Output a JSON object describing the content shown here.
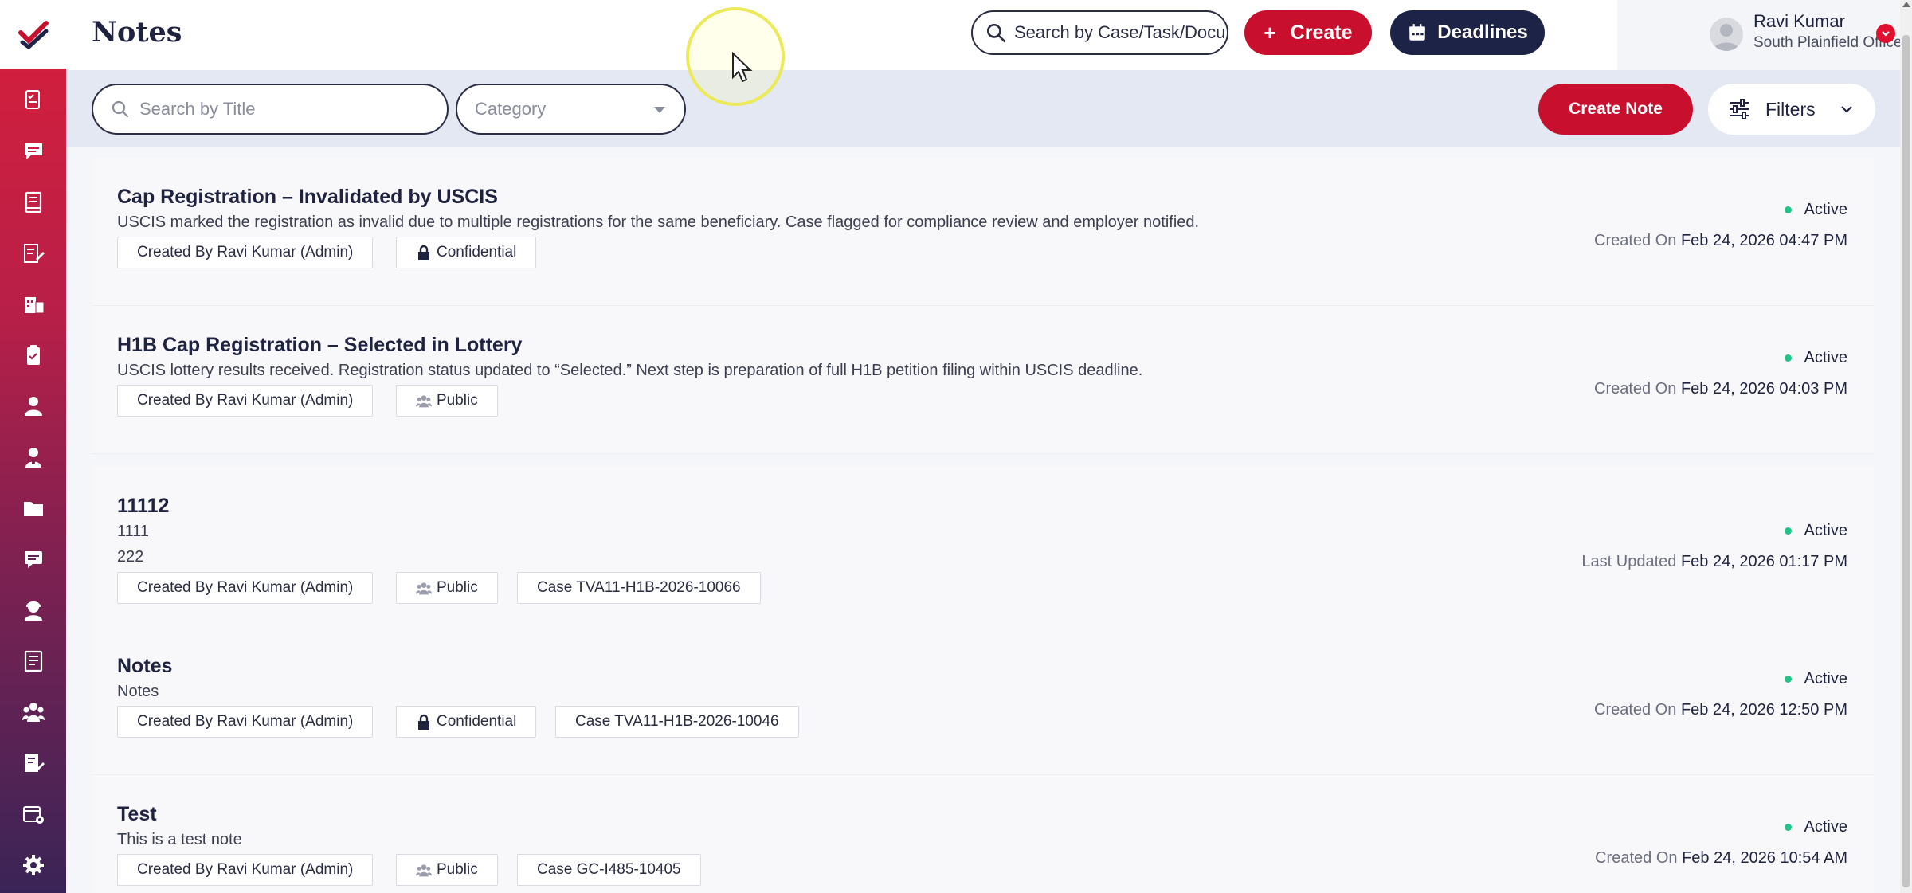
{
  "app": {
    "title": "Notes"
  },
  "header": {
    "global_search_placeholder": "Search by Case/Task/Docu",
    "create_label": "Create",
    "create_icon": "+",
    "deadlines_label": "Deadlines",
    "user": {
      "name": "Ravi Kumar",
      "office": "South Plainfield Office"
    }
  },
  "filters": {
    "title_search_placeholder": "Search by Title",
    "category_placeholder": "Category",
    "create_note_label": "Create Note",
    "filters_label": "Filters"
  },
  "sidebar": {
    "icons": [
      "checklist-doc-icon",
      "chat-icon",
      "book-icon",
      "document-edit-icon",
      "building-doc-icon",
      "clipboard-icon",
      "person-icon",
      "user-icon",
      "folder-icon",
      "message-icon",
      "support-agent-icon",
      "ledger-icon",
      "group-icon",
      "signed-doc-icon",
      "calendar-settings-icon",
      "settings-icon"
    ]
  },
  "notes": [
    {
      "title": "Cap Registration – Invalidated by USCIS",
      "lines": [
        "USCIS marked the registration as invalid due to multiple registrations for the same beneficiary. Case flagged for compliance review and employer notified."
      ],
      "created_by": "Created By Ravi Kumar (Admin)",
      "visibility": "Confidential",
      "visibility_icon": "lock-icon",
      "status": "Active",
      "meta_label": "Created On",
      "meta_value": "Feb 24, 2026 04:47 PM"
    },
    {
      "title": "H1B Cap Registration – Selected in Lottery",
      "lines": [
        "USCIS lottery results received. Registration status updated to “Selected.” Next step is preparation of full H1B petition filing within USCIS deadline."
      ],
      "created_by": "Created By Ravi Kumar (Admin)",
      "visibility": "Public",
      "visibility_icon": "group-icon",
      "status": "Active",
      "meta_label": "Created On",
      "meta_value": "Feb 24, 2026 04:03 PM"
    },
    {
      "title": "11112",
      "lines": [
        "1111",
        "222"
      ],
      "created_by": "Created By Ravi Kumar (Admin)",
      "visibility": "Public",
      "visibility_icon": "group-icon",
      "case": "Case TVA11-H1B-2026-10066",
      "status": "Active",
      "meta_label": "Last Updated",
      "meta_value": "Feb 24, 2026 01:17 PM"
    },
    {
      "title": "Notes",
      "lines": [
        "Notes"
      ],
      "created_by": "Created By Ravi Kumar (Admin)",
      "visibility": "Confidential",
      "visibility_icon": "lock-icon",
      "case": "Case TVA11-H1B-2026-10046",
      "status": "Active",
      "meta_label": "Created On",
      "meta_value": "Feb 24, 2026 12:50 PM"
    },
    {
      "title": "Test",
      "lines": [
        "This is a test note"
      ],
      "created_by": "Created By Ravi Kumar (Admin)",
      "visibility": "Public",
      "visibility_icon": "group-icon",
      "case": "Case GC-I485-10405",
      "status": "Active",
      "meta_label": "Created On",
      "meta_value": "Feb 24, 2026 10:54 AM"
    }
  ],
  "colors": {
    "brand_red": "#c8102e",
    "navy": "#1c2346",
    "status_active": "#22c386"
  }
}
